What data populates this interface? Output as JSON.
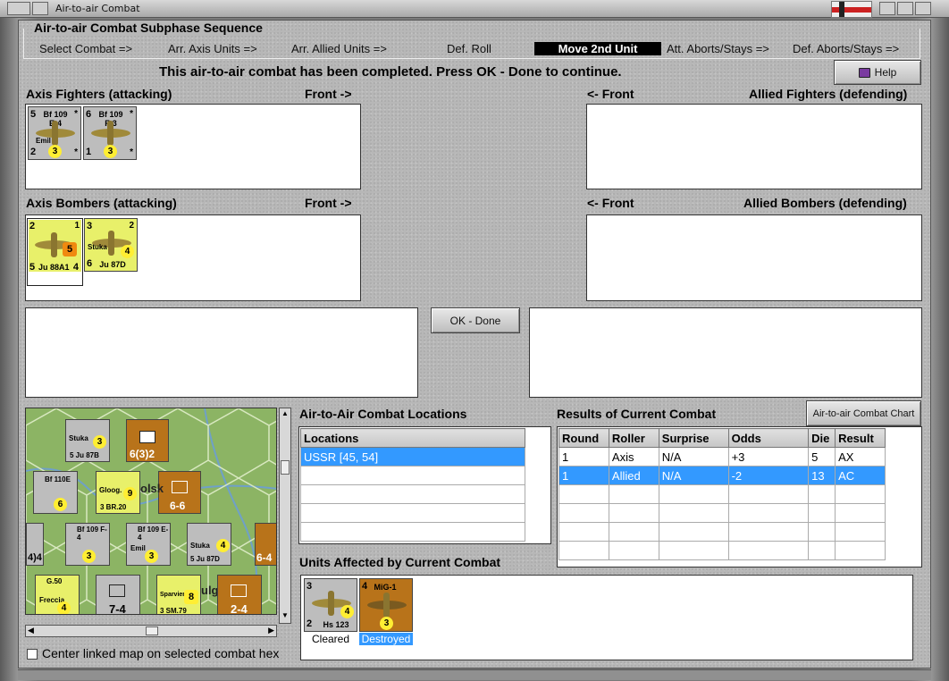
{
  "window": {
    "title": "Air-to-air Combat"
  },
  "sequence": {
    "title": "Air-to-air Combat Subphase Sequence",
    "steps": [
      "Select Combat =>",
      "Arr. Axis Units =>",
      "Arr. Allied Units =>",
      "Def. Roll",
      "Move 2nd Unit",
      "Att. Aborts/Stays =>",
      "Def. Aborts/Stays =>"
    ],
    "active_index": 4
  },
  "message": "This air-to-air combat has been completed.  Press OK - Done to continue.",
  "help_label": "Help",
  "ok_label": "OK - Done",
  "panels": {
    "axis_fighters": "Axis Fighters (attacking)",
    "allied_fighters": "Allied Fighters (defending)",
    "axis_bombers": "Axis Bombers (attacking)",
    "allied_bombers": "Allied Bombers (defending)",
    "front_right": "Front ->",
    "front_left": "<- Front"
  },
  "axis_fighters": [
    {
      "name": "Bf 109",
      "model": "E-4",
      "tl": "5",
      "bl": "2",
      "tag": "Emil",
      "dot": "3",
      "br": "*",
      "tr": "*"
    },
    {
      "name": "Bf 109",
      "model": "F-3",
      "tl": "6",
      "bl": "1",
      "tag": "",
      "dot": "3",
      "br": "*",
      "tr": "*"
    }
  ],
  "axis_bombers": [
    {
      "name": "Ju 88A1",
      "tl": "2",
      "tr": "1",
      "bl": "5",
      "br": "4",
      "orange": "5"
    },
    {
      "name": "Ju 87D",
      "tl": "3",
      "tr": "2",
      "bl": "6",
      "br": "",
      "dot": "4",
      "tag": "Stuka"
    }
  ],
  "locations": {
    "title": "Air-to-Air Combat Locations",
    "header": "Locations",
    "rows": [
      "USSR [45, 54]"
    ]
  },
  "results": {
    "title": "Results of Current Combat",
    "chart_button": "Air-to-air Combat Chart",
    "headers": [
      "Round",
      "Roller",
      "Surprise",
      "Odds",
      "Die",
      "Result"
    ],
    "rows": [
      [
        "1",
        "Axis",
        "N/A",
        "+3",
        "5",
        "AX"
      ],
      [
        "1",
        "Allied",
        "N/A",
        "-2",
        "13",
        "AC"
      ]
    ]
  },
  "affected": {
    "title": "Units Affected by Current Combat",
    "units": [
      {
        "name": "Hs 123",
        "tl": "3",
        "bl": "2",
        "dot": "4",
        "status": "Cleared"
      },
      {
        "name": "MiG-1",
        "tl": "4",
        "dot": "3",
        "status": "Destroyed"
      }
    ]
  },
  "checkbox_label": "Center linked map on selected combat hex",
  "map": {
    "units": [
      {
        "t": "Stuka",
        "b": "5 Ju 87B",
        "n": "3"
      },
      {
        "t": "Bf 110E",
        "b": "",
        "n": "6"
      },
      {
        "t": "Gloog.",
        "b": "3 BR.20",
        "n": "9"
      },
      {
        "t": "6-6",
        "b": "",
        "n": ""
      },
      {
        "t": "Bf 109 F-4",
        "b": "",
        "n": "3"
      },
      {
        "t": "Bf 109 E-4",
        "b": "Emil",
        "n": "3"
      },
      {
        "t": "Stuka",
        "b": "5 Ju 87D",
        "n": "4"
      },
      {
        "t": "6-4",
        "b": "",
        "n": ""
      },
      {
        "t": "G.50",
        "b": "Freccia",
        "n": "4"
      },
      {
        "t": "7-4",
        "b": "",
        "n": ""
      },
      {
        "t": "Sparviero",
        "b": "3 SM.79",
        "n": "8"
      },
      {
        "t": "2-4",
        "b": "",
        "n": ""
      },
      {
        "t": "6(3)2",
        "b": "",
        "n": ""
      },
      {
        "t": "4)4",
        "b": "",
        "n": ""
      },
      {
        "t": "olsk",
        "b": "",
        "n": ""
      },
      {
        "t": "ulgi",
        "b": "",
        "n": ""
      }
    ]
  }
}
